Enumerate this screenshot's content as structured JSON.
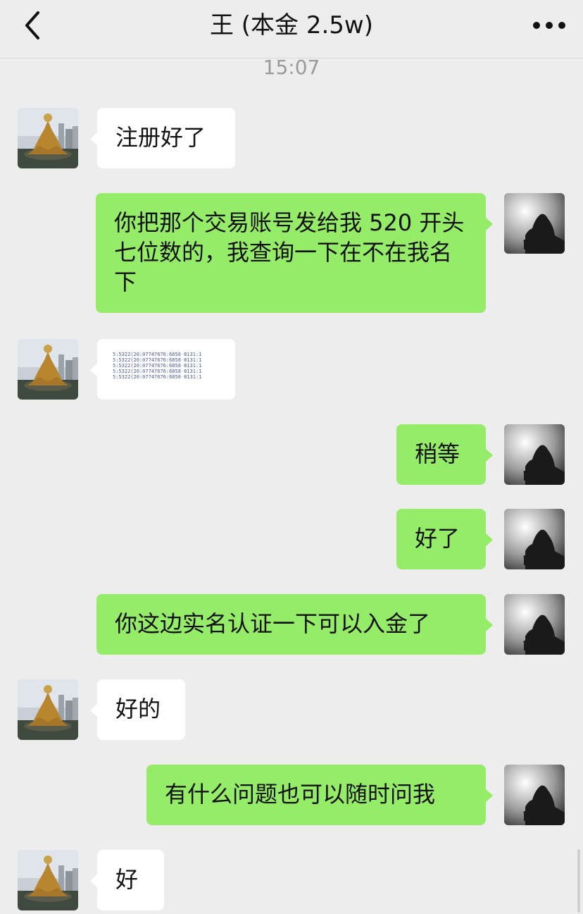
{
  "header": {
    "title": "王 (本金 2.5w)",
    "back_icon": "chevron-left-icon",
    "more_icon": "more-dots-icon"
  },
  "timestamp": "15:07",
  "messages": [
    {
      "side": "left",
      "text": "注册好了"
    },
    {
      "side": "right",
      "text": "你把那个交易账号发给我 520 开头七位数的，我查询一下在不在我名下"
    },
    {
      "side": "left",
      "type": "image",
      "image_lines": [
        "5:5322(20:07747676:6858 8131:1",
        "5:5322(20:07747676:6858 8131:1",
        "5:5322(20:07747676:6858 8131:1",
        "5:5322(20:07747676:6858 8131:1",
        "5:5322(20:07747676:6858 8131:1"
      ]
    },
    {
      "side": "right",
      "text": "稍等"
    },
    {
      "side": "right",
      "text": "好了"
    },
    {
      "side": "right",
      "text": "你这边实名认证一下可以入金了"
    },
    {
      "side": "left",
      "text": "好的"
    },
    {
      "side": "right",
      "text": "有什么问题也可以随时问我"
    },
    {
      "side": "left",
      "text": "好"
    }
  ],
  "colors": {
    "background": "#ededed",
    "self_bubble": "#95ec69",
    "other_bubble": "#ffffff"
  }
}
